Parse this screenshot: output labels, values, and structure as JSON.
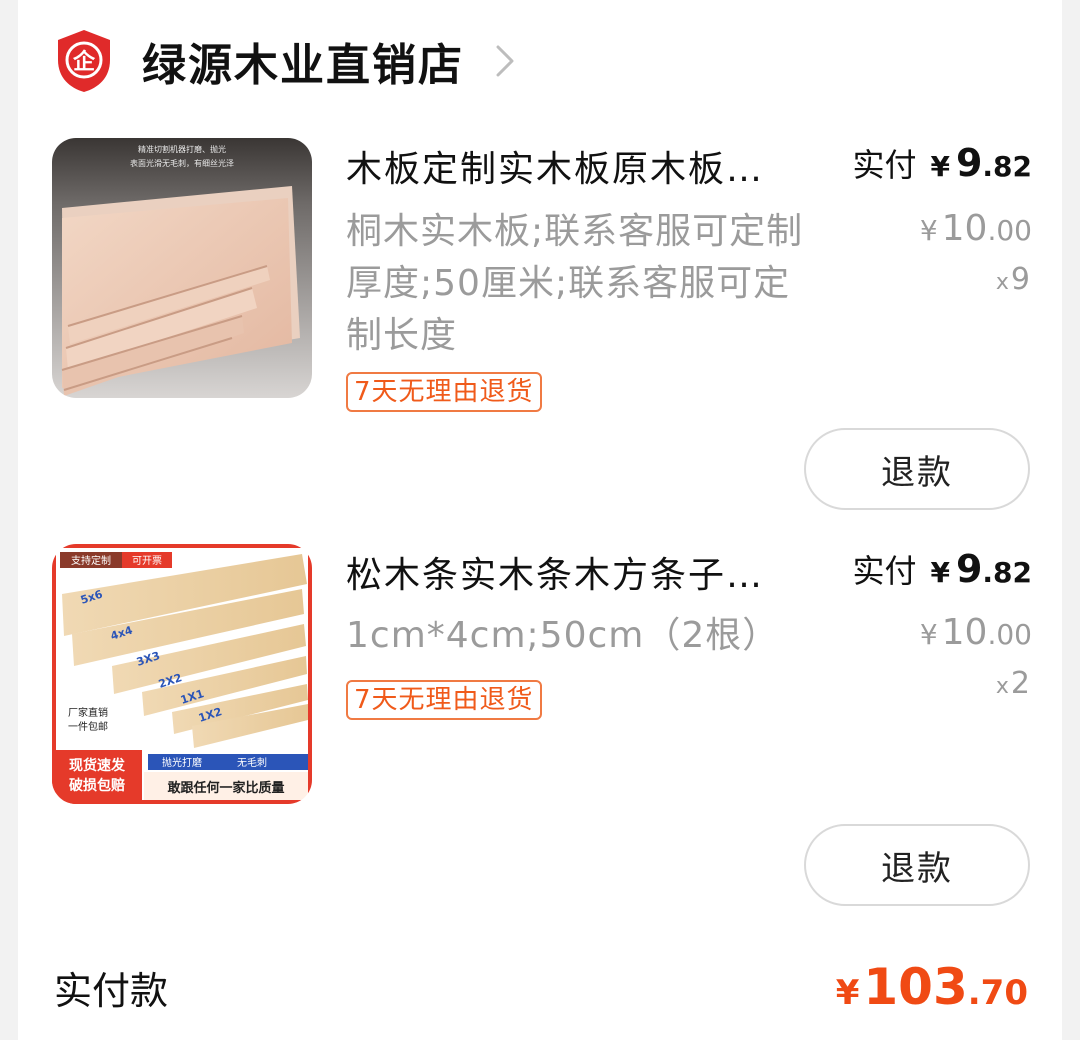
{
  "shop": {
    "badge_icon": "enterprise-shield-icon",
    "badge_glyph": "企",
    "name": "绿源木业直销店",
    "chevron_icon": "chevron-right-icon",
    "brand_color": "#e02a2a"
  },
  "items": [
    {
      "thumb_icon": "wood-board-product-image",
      "thumb_caption": "精准切割机器打磨、抛光 表面光滑无毛刺，有细丝光泽",
      "title": "木板定制实木板原木板…",
      "spec": "桐木实木板;联系客服可定制厚度;50厘米;联系客服可定制长度",
      "tag": "7天无理由退货",
      "paid_label": "实付",
      "paid_yen": "¥",
      "paid_int": "9",
      "paid_dec": ".82",
      "orig_yen": "¥",
      "orig_int": "10",
      "orig_dec": ".00",
      "qty_x": "x",
      "qty": "9",
      "refund_label": "退款"
    },
    {
      "thumb_icon": "pine-wood-strips-product-image",
      "thumb_badges": [
        "支持定制",
        "可开票"
      ],
      "thumb_sizes": [
        "5x6",
        "4x4",
        "3X3",
        "2X2",
        "1X1",
        "1X2"
      ],
      "thumb_notes": [
        "厂家直销",
        "一件包邮"
      ],
      "thumb_banner_left": [
        "现货速发",
        "破损包赔"
      ],
      "thumb_banner_right_top": [
        "抛光打磨",
        "无毛刺"
      ],
      "thumb_banner_right": "敢跟任何一家比质量",
      "title": "松木条实木条木方条子…",
      "spec": "1cm*4cm;50cm（2根）",
      "tag": "7天无理由退货",
      "paid_label": "实付",
      "paid_yen": "¥",
      "paid_int": "9",
      "paid_dec": ".82",
      "orig_yen": "¥",
      "orig_int": "10",
      "orig_dec": ".00",
      "qty_x": "x",
      "qty": "2",
      "refund_label": "退款"
    }
  ],
  "summary": {
    "label": "实付款",
    "yen": "¥",
    "int": "103",
    "dec": ".70",
    "accent_color": "#f04a14"
  }
}
